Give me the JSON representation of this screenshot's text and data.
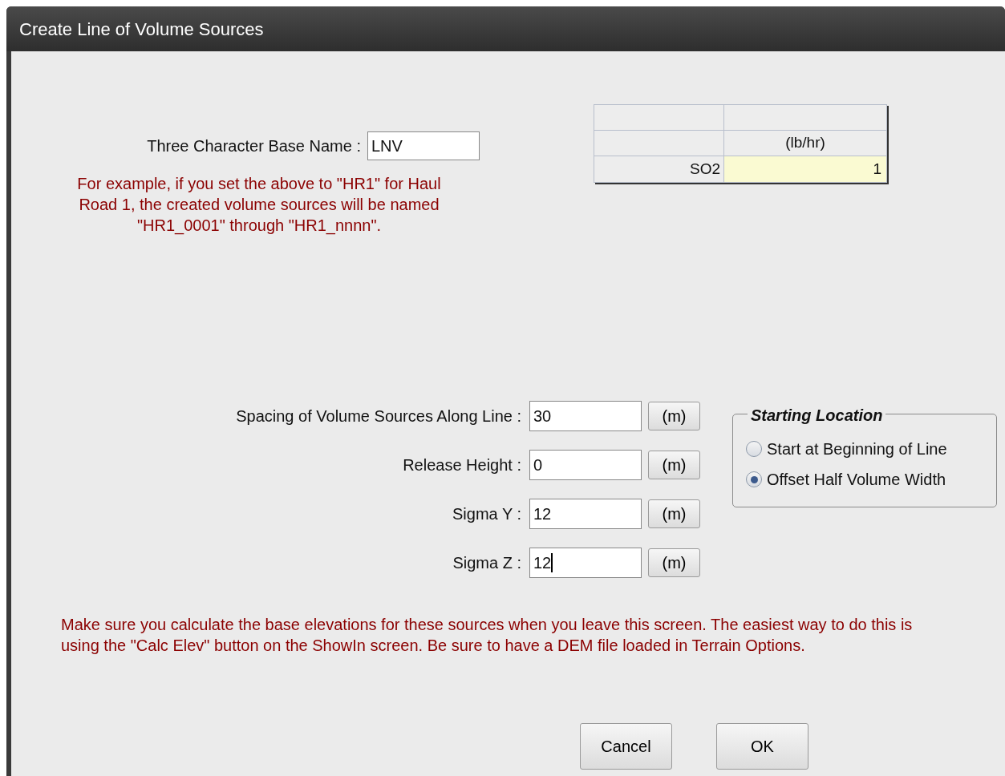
{
  "window": {
    "title": "Create Line of Volume Sources"
  },
  "base_name": {
    "label": "Three Character Base Name :",
    "value": "LNV"
  },
  "example_note": "For example, if you set the above to \"HR1\" for Haul Road 1, the created volume sources will be named \"HR1_0001\" through \"HR1_nnnn\".",
  "emission_table": {
    "unit_row": {
      "column_2": "(lb/hr)"
    },
    "rows": [
      {
        "pollutant": "SO2",
        "rate": "1",
        "highlighted": true
      }
    ]
  },
  "parameters": [
    {
      "label": "Spacing of Volume Sources Along Line :",
      "value": "30",
      "unit": "(m)",
      "focused": false
    },
    {
      "label": "Release Height :",
      "value": "0",
      "unit": "(m)",
      "focused": false
    },
    {
      "label": "Sigma Y :",
      "value": "12",
      "unit": "(m)",
      "focused": false
    },
    {
      "label": "Sigma Z :",
      "value": "12",
      "unit": "(m)",
      "focused": true
    }
  ],
  "starting_location": {
    "title": "Starting Location",
    "options": [
      {
        "label": "Start at Beginning of Line",
        "selected": false
      },
      {
        "label": "Offset Half Volume Width",
        "selected": true
      }
    ]
  },
  "elevation_note": "Make sure you calculate the base elevations for these sources when you leave this screen.  The easiest way to do this is using the \"Calc Elev\" button on the ShowIn screen.  Be sure to have a DEM file loaded in Terrain Options.",
  "buttons": [
    "Cancel",
    "OK"
  ]
}
